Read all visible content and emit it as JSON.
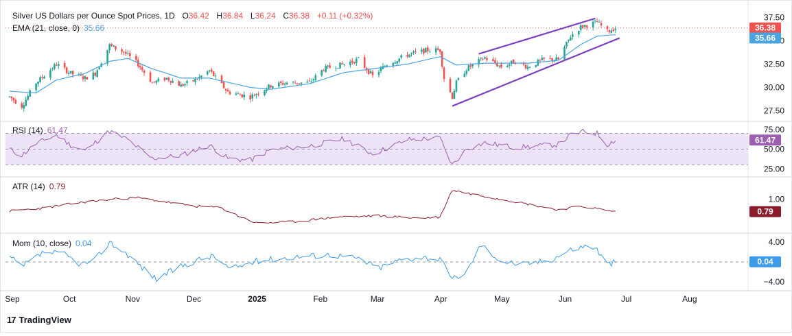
{
  "header": {
    "title": "Silver US Dollars per Ounce Spot Prices, 1D",
    "open_label": "O",
    "open": "36.42",
    "high_label": "H",
    "high": "36.84",
    "low_label": "L",
    "low": "36.24",
    "close_label": "C",
    "close": "36.38",
    "change": "+0.11 (+0.32%)"
  },
  "ema_legend": {
    "label": "EMA (21, close, 0)",
    "value": "35.66"
  },
  "rsi_legend": {
    "label": "RSI (14)",
    "value": "61.47"
  },
  "atr_legend": {
    "label": "ATR (14)",
    "value": "0.79"
  },
  "mom_legend": {
    "label": "Mom (10, close)",
    "value": "0.04"
  },
  "brand": {
    "text": "TradingView"
  },
  "colors": {
    "up": "#26a69a",
    "down": "#ef5350",
    "ema": "#4aa3df",
    "rsi": "#9c5fb0",
    "rsi_band": "#ede3f7",
    "atr": "#8b1c2b",
    "mom": "#3d9be9",
    "channel": "#7b3fbf"
  },
  "chart_data": [
    {
      "type": "candlestick",
      "panel": "price",
      "title": "Silver US Dollars per Ounce Spot Prices, 1D",
      "x_ticks": [
        "Sep",
        "Oct",
        "Nov",
        "Dec",
        "2025",
        "Feb",
        "Mar",
        "Apr",
        "May",
        "Jun",
        "Jul",
        "Aug"
      ],
      "x_range": [
        "2024-09-01",
        "2025-08-31"
      ],
      "y_ticks": [
        27.5,
        30.0,
        32.5,
        35.0,
        37.5
      ],
      "y_ticks_text": [
        "27.50",
        "30.00",
        "32.50",
        "35.00",
        "37.50"
      ],
      "ylim": [
        26.8,
        38.2
      ],
      "price_label": "36.38",
      "ema_label": "35.66",
      "price_anchors": [
        [
          "2024-09-03",
          29.0
        ],
        [
          "2024-09-09",
          28.0
        ],
        [
          "2024-09-16",
          30.5
        ],
        [
          "2024-09-26",
          32.5
        ],
        [
          "2024-10-03",
          31.5
        ],
        [
          "2024-10-10",
          31.0
        ],
        [
          "2024-10-15",
          31.5
        ],
        [
          "2024-10-22",
          34.5
        ],
        [
          "2024-10-29",
          33.8
        ],
        [
          "2024-11-05",
          32.5
        ],
        [
          "2024-11-12",
          30.5
        ],
        [
          "2024-11-19",
          31.0
        ],
        [
          "2024-11-26",
          30.2
        ],
        [
          "2024-12-03",
          30.8
        ],
        [
          "2024-12-10",
          31.8
        ],
        [
          "2024-12-19",
          29.5
        ],
        [
          "2024-12-30",
          29.0
        ],
        [
          "2025-01-09",
          30.2
        ],
        [
          "2025-01-17",
          30.5
        ],
        [
          "2025-01-28",
          30.5
        ],
        [
          "2025-02-04",
          32.0
        ],
        [
          "2025-02-14",
          32.5
        ],
        [
          "2025-02-21",
          33.0
        ],
        [
          "2025-02-28",
          31.2
        ],
        [
          "2025-03-07",
          32.5
        ],
        [
          "2025-03-17",
          33.5
        ],
        [
          "2025-03-27",
          34.0
        ],
        [
          "2025-04-02",
          34.0
        ],
        [
          "2025-04-04",
          31.0
        ],
        [
          "2025-04-08",
          29.0
        ],
        [
          "2025-04-10",
          30.5
        ],
        [
          "2025-04-15",
          32.0
        ],
        [
          "2025-04-24",
          33.2
        ],
        [
          "2025-05-02",
          32.2
        ],
        [
          "2025-05-09",
          32.8
        ],
        [
          "2025-05-15",
          32.2
        ],
        [
          "2025-05-23",
          33.0
        ],
        [
          "2025-05-30",
          33.0
        ],
        [
          "2025-06-05",
          35.5
        ],
        [
          "2025-06-10",
          36.5
        ],
        [
          "2025-06-18",
          37.0
        ],
        [
          "2025-06-23",
          36.0
        ],
        [
          "2025-06-27",
          36.38
        ]
      ],
      "ema_anchors": [
        [
          "2024-09-03",
          29.6
        ],
        [
          "2024-09-16",
          29.4
        ],
        [
          "2024-09-26",
          30.8
        ],
        [
          "2024-10-10",
          31.5
        ],
        [
          "2024-10-22",
          32.8
        ],
        [
          "2024-10-31",
          33.1
        ],
        [
          "2024-11-12",
          32.0
        ],
        [
          "2024-11-26",
          31.0
        ],
        [
          "2024-12-10",
          31.0
        ],
        [
          "2024-12-30",
          30.0
        ],
        [
          "2025-01-09",
          29.8
        ],
        [
          "2025-01-28",
          30.4
        ],
        [
          "2025-02-14",
          31.6
        ],
        [
          "2025-02-28",
          32.0
        ],
        [
          "2025-03-17",
          32.5
        ],
        [
          "2025-04-02",
          33.3
        ],
        [
          "2025-04-10",
          32.4
        ],
        [
          "2025-04-24",
          32.6
        ],
        [
          "2025-05-15",
          32.6
        ],
        [
          "2025-05-30",
          32.9
        ],
        [
          "2025-06-10",
          34.6
        ],
        [
          "2025-06-18",
          35.5
        ],
        [
          "2025-06-27",
          35.66
        ]
      ],
      "channel_lines": [
        {
          "from": [
            "2025-04-08",
            28.0
          ],
          "to": [
            "2025-06-29",
            35.3
          ]
        },
        {
          "from": [
            "2025-04-21",
            33.6
          ],
          "to": [
            "2025-06-17",
            37.4
          ]
        }
      ]
    },
    {
      "type": "line",
      "panel": "rsi",
      "name": "RSI (14)",
      "y_ticks": [
        25,
        50,
        75
      ],
      "y_ticks_text": [
        "25.00",
        "50.00",
        "75.00"
      ],
      "ylim": [
        20,
        80
      ],
      "band": [
        30,
        70
      ],
      "value_label": "61.47",
      "anchors": [
        [
          "2024-09-03",
          50
        ],
        [
          "2024-09-09",
          42
        ],
        [
          "2024-09-16",
          57
        ],
        [
          "2024-09-26",
          68
        ],
        [
          "2024-10-03",
          55
        ],
        [
          "2024-10-10",
          48
        ],
        [
          "2024-10-22",
          73
        ],
        [
          "2024-10-31",
          62
        ],
        [
          "2024-11-05",
          52
        ],
        [
          "2024-11-12",
          38
        ],
        [
          "2024-11-26",
          42
        ],
        [
          "2024-12-10",
          55
        ],
        [
          "2024-12-19",
          38
        ],
        [
          "2024-12-30",
          36
        ],
        [
          "2025-01-09",
          49
        ],
        [
          "2025-01-28",
          54
        ],
        [
          "2025-02-14",
          63
        ],
        [
          "2025-02-28",
          44
        ],
        [
          "2025-03-17",
          62
        ],
        [
          "2025-04-02",
          64
        ],
        [
          "2025-04-08",
          30
        ],
        [
          "2025-04-15",
          50
        ],
        [
          "2025-04-24",
          58
        ],
        [
          "2025-05-09",
          52
        ],
        [
          "2025-05-30",
          56
        ],
        [
          "2025-06-05",
          68
        ],
        [
          "2025-06-11",
          72
        ],
        [
          "2025-06-18",
          70
        ],
        [
          "2025-06-23",
          56
        ],
        [
          "2025-06-27",
          61.47
        ]
      ]
    },
    {
      "type": "line",
      "panel": "atr",
      "name": "ATR (14)",
      "y_ticks": [
        1.0
      ],
      "y_ticks_text": [
        "1.00"
      ],
      "ylim": [
        0.5,
        1.3
      ],
      "value_label": "0.79",
      "anchors": [
        [
          "2024-09-03",
          0.8
        ],
        [
          "2024-09-20",
          0.85
        ],
        [
          "2024-10-03",
          0.92
        ],
        [
          "2024-10-10",
          0.95
        ],
        [
          "2024-10-24",
          1.0
        ],
        [
          "2024-11-05",
          1.02
        ],
        [
          "2024-11-19",
          0.95
        ],
        [
          "2024-12-03",
          0.88
        ],
        [
          "2024-12-15",
          0.86
        ],
        [
          "2024-12-24",
          0.72
        ],
        [
          "2025-01-02",
          0.6
        ],
        [
          "2025-01-20",
          0.62
        ],
        [
          "2025-02-10",
          0.7
        ],
        [
          "2025-03-03",
          0.72
        ],
        [
          "2025-03-24",
          0.68
        ],
        [
          "2025-04-02",
          0.7
        ],
        [
          "2025-04-08",
          1.15
        ],
        [
          "2025-04-15",
          1.1
        ],
        [
          "2025-05-05",
          0.98
        ],
        [
          "2025-05-30",
          0.82
        ],
        [
          "2025-06-10",
          0.88
        ],
        [
          "2025-06-27",
          0.79
        ]
      ]
    },
    {
      "type": "line",
      "panel": "momentum",
      "name": "Mom (10, close)",
      "y_ticks": [
        4.0,
        -4.0
      ],
      "y_ticks_text": [
        "4.00",
        "−4.00"
      ],
      "ylim": [
        -5,
        5
      ],
      "zero_line": 0,
      "value_label": "0.04",
      "anchors": [
        [
          "2024-09-03",
          1.0
        ],
        [
          "2024-09-09",
          -1.0
        ],
        [
          "2024-09-20",
          2.0
        ],
        [
          "2024-09-30",
          1.5
        ],
        [
          "2024-10-08",
          -0.5
        ],
        [
          "2024-10-15",
          0.5
        ],
        [
          "2024-10-22",
          4.0
        ],
        [
          "2024-10-31",
          1.5
        ],
        [
          "2024-11-08",
          -1.5
        ],
        [
          "2024-11-14",
          -3.5
        ],
        [
          "2024-11-25",
          -1.0
        ],
        [
          "2024-12-05",
          0.5
        ],
        [
          "2024-12-12",
          1.2
        ],
        [
          "2024-12-20",
          -1.5
        ],
        [
          "2025-01-03",
          0.3
        ],
        [
          "2025-01-20",
          1.0
        ],
        [
          "2025-02-07",
          1.5
        ],
        [
          "2025-02-20",
          0.8
        ],
        [
          "2025-03-03",
          -1.2
        ],
        [
          "2025-03-14",
          0.5
        ],
        [
          "2025-03-24",
          1.0
        ],
        [
          "2025-04-02",
          0.5
        ],
        [
          "2025-04-08",
          -3.5
        ],
        [
          "2025-04-15",
          -2.0
        ],
        [
          "2025-04-22",
          3.5
        ],
        [
          "2025-05-02",
          0.2
        ],
        [
          "2025-05-12",
          -0.5
        ],
        [
          "2025-05-26",
          0.4
        ],
        [
          "2025-06-05",
          2.5
        ],
        [
          "2025-06-12",
          3.2
        ],
        [
          "2025-06-17",
          3.0
        ],
        [
          "2025-06-23",
          -0.5
        ],
        [
          "2025-06-27",
          0.04
        ]
      ]
    }
  ]
}
